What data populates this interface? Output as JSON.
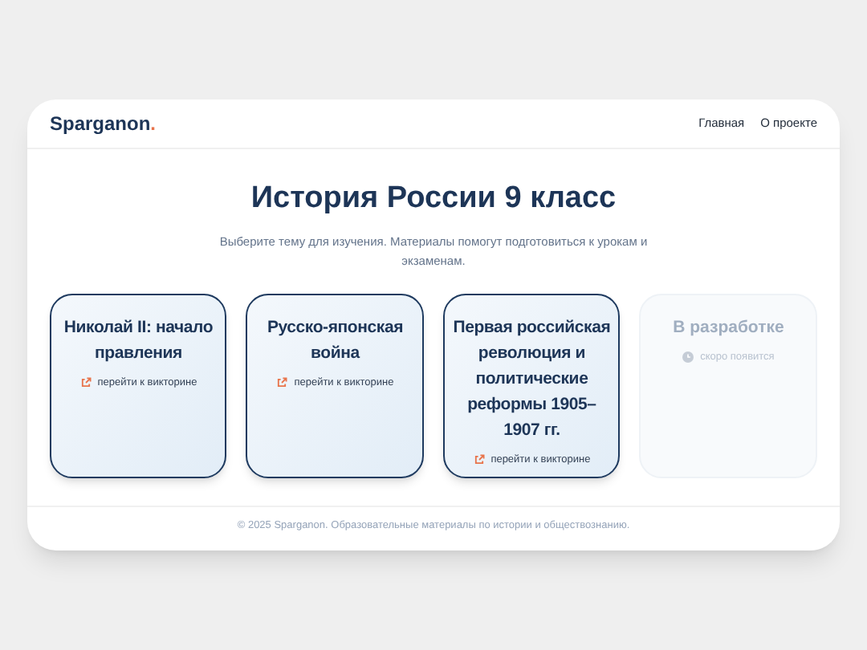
{
  "header": {
    "logo": "Sparganon",
    "logo_dot": ".",
    "nav": [
      {
        "label": "Главная"
      },
      {
        "label": "О проекте"
      }
    ]
  },
  "title": "История России 9 класс",
  "subtitle": "Выберите тему для изучения. Материалы помогут подготовиться к урокам и экзаменам.",
  "cards": [
    {
      "kind": "quiz",
      "title": "Николай II: начало правления",
      "link": "перейти к викторине"
    },
    {
      "kind": "quiz",
      "title": "Русско-японская война",
      "link": "перейти к викторине"
    },
    {
      "kind": "quiz",
      "title": "Первая российская революция и политические реформы 1905–1907 гг.",
      "link": "перейти к викторине"
    },
    {
      "kind": "soon",
      "title": "В разработке",
      "link": "скоро появится"
    }
  ],
  "footer": "© 2025 Sparganon. Образовательные материалы по истории и обществознанию."
}
